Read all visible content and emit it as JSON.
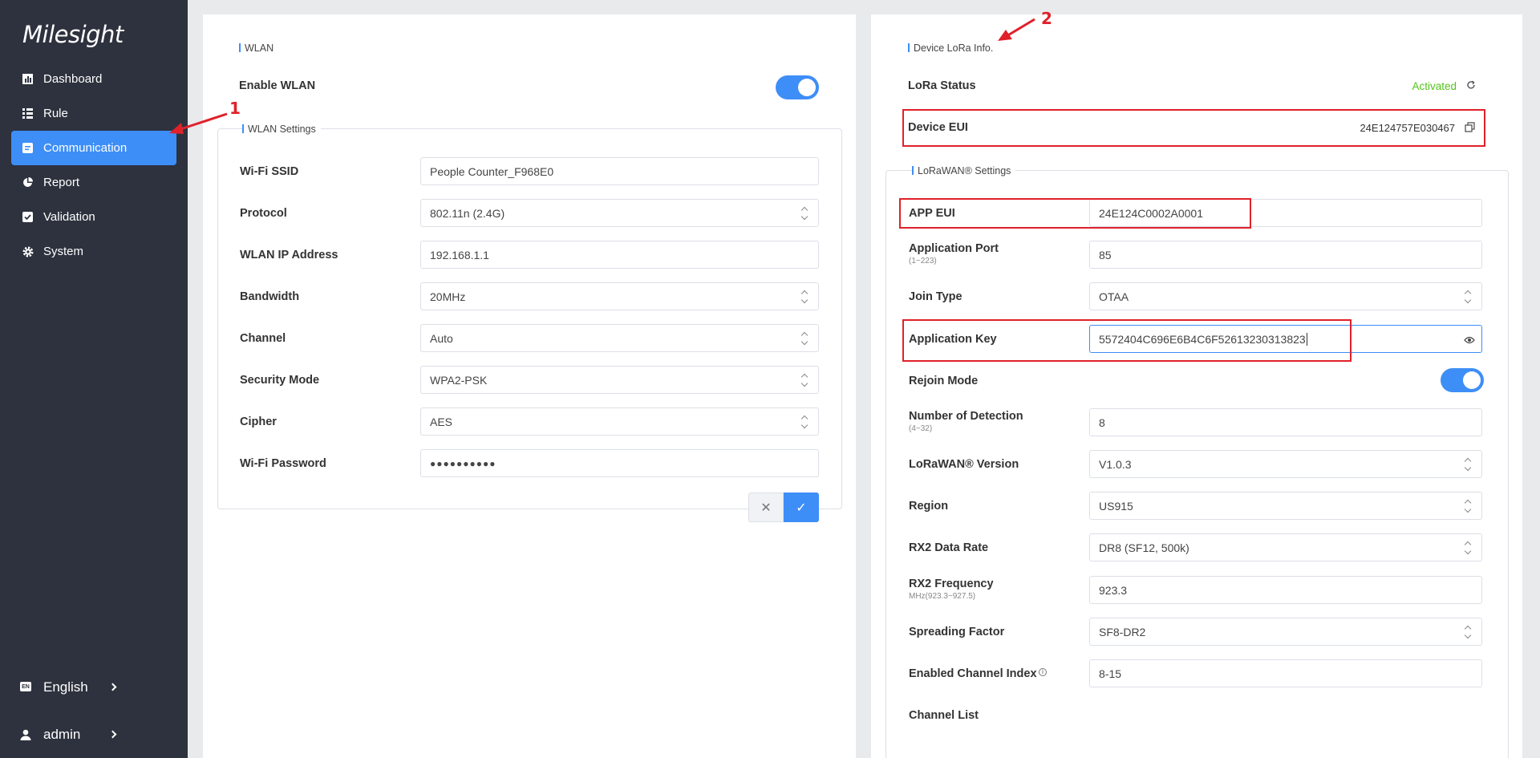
{
  "brand": {
    "logo_text": "Milesight"
  },
  "sidebar": {
    "items": [
      {
        "label": "Dashboard",
        "icon": "chart-icon"
      },
      {
        "label": "Rule",
        "icon": "list-icon"
      },
      {
        "label": "Communication",
        "icon": "document-icon",
        "active": true
      },
      {
        "label": "Report",
        "icon": "pie-chart-icon"
      },
      {
        "label": "Validation",
        "icon": "check-icon"
      },
      {
        "label": "System",
        "icon": "gear-icon"
      }
    ],
    "language": {
      "badge": "EN",
      "label": "English"
    },
    "user": {
      "label": "admin"
    }
  },
  "wlan": {
    "title": "WLAN",
    "enable_label": "Enable WLAN",
    "enabled": true,
    "settings_title": "WLAN Settings",
    "fields": [
      {
        "label": "Wi-Fi SSID",
        "value": "People Counter_F968E0",
        "type": "text"
      },
      {
        "label": "Protocol",
        "value": "802.11n (2.4G)",
        "type": "select"
      },
      {
        "label": "WLAN IP Address",
        "value": "192.168.1.1",
        "type": "text"
      },
      {
        "label": "Bandwidth",
        "value": "20MHz",
        "type": "select"
      },
      {
        "label": "Channel",
        "value": "Auto",
        "type": "select"
      },
      {
        "label": "Security Mode",
        "value": "WPA2-PSK",
        "type": "select"
      },
      {
        "label": "Cipher",
        "value": "AES",
        "type": "select"
      },
      {
        "label": "Wi-Fi Password",
        "value": "●●●●●●●●●●",
        "type": "password"
      }
    ],
    "cancel_symbol": "✕",
    "save_symbol": "✓"
  },
  "lora": {
    "title": "Device LoRa Info.",
    "status_label": "LoRa Status",
    "status_value": "Activated",
    "status_color": "#52c41a",
    "eui_label": "Device EUI",
    "eui_value": "24E124757E030467",
    "settings_title": "LoRaWAN® Settings",
    "fields": [
      {
        "label": "APP EUI",
        "sub": "",
        "value": "24E124C0002A0001",
        "type": "text"
      },
      {
        "label": "Application Port",
        "sub": "(1~223)",
        "value": "85",
        "type": "text"
      },
      {
        "label": "Join Type",
        "sub": "",
        "value": "OTAA",
        "type": "select"
      },
      {
        "label": "Application Key",
        "sub": "",
        "value": "5572404C696E6B4C6F52613230313823",
        "type": "key"
      },
      {
        "label": "Rejoin Mode",
        "sub": "",
        "value": "",
        "type": "toggle"
      },
      {
        "label": "Number of Detection",
        "sub": "(4~32)",
        "value": "8",
        "type": "text"
      },
      {
        "label": "LoRaWAN® Version",
        "sub": "",
        "value": "V1.0.3",
        "type": "select"
      },
      {
        "label": "Region",
        "sub": "",
        "value": "US915",
        "type": "select"
      },
      {
        "label": "RX2 Data Rate",
        "sub": "",
        "value": "DR8 (SF12, 500k)",
        "type": "select"
      },
      {
        "label": "RX2 Frequency",
        "sub": "MHz(923.3~927.5)",
        "value": "923.3",
        "type": "text"
      },
      {
        "label": "Spreading Factor",
        "sub": "",
        "value": "SF8-DR2",
        "type": "select"
      },
      {
        "label": "Enabled Channel Index",
        "sub": "",
        "value": "8-15",
        "type": "text"
      },
      {
        "label": "Channel List",
        "sub": "",
        "value": "",
        "type": "heading"
      }
    ]
  },
  "annotations": {
    "first": "1",
    "second": "2"
  },
  "colors": {
    "accent": "#3e8ef7",
    "sidebar_bg": "#2d323e",
    "highlight": "#e0212a"
  }
}
